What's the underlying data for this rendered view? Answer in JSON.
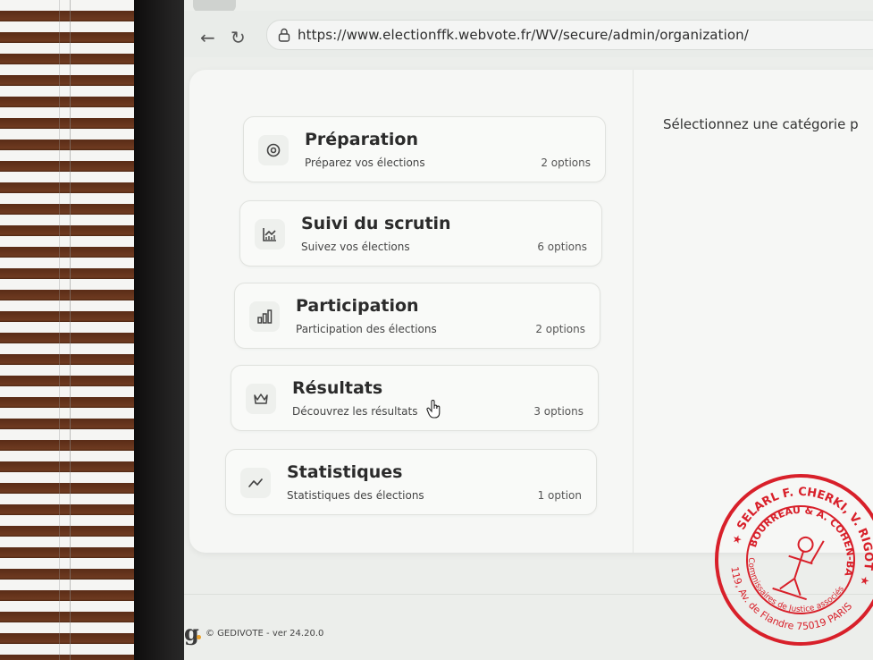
{
  "browser": {
    "url": "https://www.electionffk.webvote.fr/WV/secure/admin/organization/"
  },
  "main": {
    "prompt": "Sélectionnez une catégorie p"
  },
  "categories": [
    {
      "title": "Préparation",
      "subtitle": "Préparez vos élections",
      "count": "2 options",
      "icon": "settings-icon"
    },
    {
      "title": "Suivi du scrutin",
      "subtitle": "Suivez vos élections",
      "count": "6 options",
      "icon": "monitoring-chart-icon"
    },
    {
      "title": "Participation",
      "subtitle": "Participation des élections",
      "count": "2 options",
      "icon": "bar-chart-icon"
    },
    {
      "title": "Résultats",
      "subtitle": "Découvrez les résultats",
      "count": "3 options",
      "icon": "crown-icon"
    },
    {
      "title": "Statistiques",
      "subtitle": "Statistiques des élections",
      "count": "1 option",
      "icon": "trend-line-icon"
    }
  ],
  "footer": {
    "logo": "g",
    "text": "© GEDIVOTE - ver 24.20.0"
  },
  "stamp": {
    "line1": "SELARL F. CHERKI, V. RIGOT",
    "line2": "M. BOURREAU & A. COHEN-BACRI",
    "line3": "Commissaires de Justice associés",
    "line4": "119, Av. de Flandre 75019 PARIS"
  },
  "colors": {
    "stamp": "#d8202a",
    "accent_dot": "#e8a02a"
  }
}
